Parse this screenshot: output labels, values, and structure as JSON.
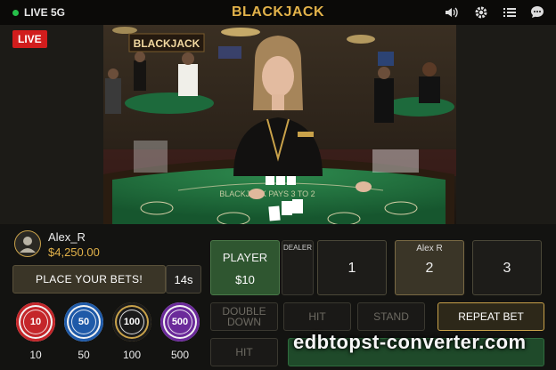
{
  "topbar": {
    "live_label": "LIVE 5G",
    "title": "BLACKJACK",
    "icons": [
      "speaker-icon",
      "gear-icon",
      "list-icon",
      "chat-icon"
    ]
  },
  "stream": {
    "live_badge": "LIVE"
  },
  "player_info": {
    "name": "Alex_R",
    "balance": "$4,250.00"
  },
  "status": {
    "message": "PLACE YOUR BETS!",
    "timer": "14s"
  },
  "chips": [
    {
      "value": "10",
      "color": "#c4262a"
    },
    {
      "value": "50",
      "color": "#1f5aa8"
    },
    {
      "value": "100",
      "color": "#1b1b1b"
    },
    {
      "value": "500",
      "color": "#6b2a9a"
    }
  ],
  "bet_spots": {
    "player_label": "PLAYER",
    "player_amount": "$10",
    "dealer_label": "DEALER",
    "seats": [
      {
        "number": "1",
        "name": ""
      },
      {
        "number": "2",
        "name": "Alex R"
      },
      {
        "number": "3",
        "name": ""
      }
    ]
  },
  "actions": {
    "double_down": "DOUBLE DOWN",
    "hit": "HIT",
    "stand": "STAND",
    "repeat_bet": "REPEAT BET",
    "hit_bottom": "HIT"
  },
  "watermark": "edbtopst-converter.com",
  "colors": {
    "accent_gold": "#e2b24a",
    "live_red": "#d11d1d",
    "table_green": "#1f6a3a"
  }
}
